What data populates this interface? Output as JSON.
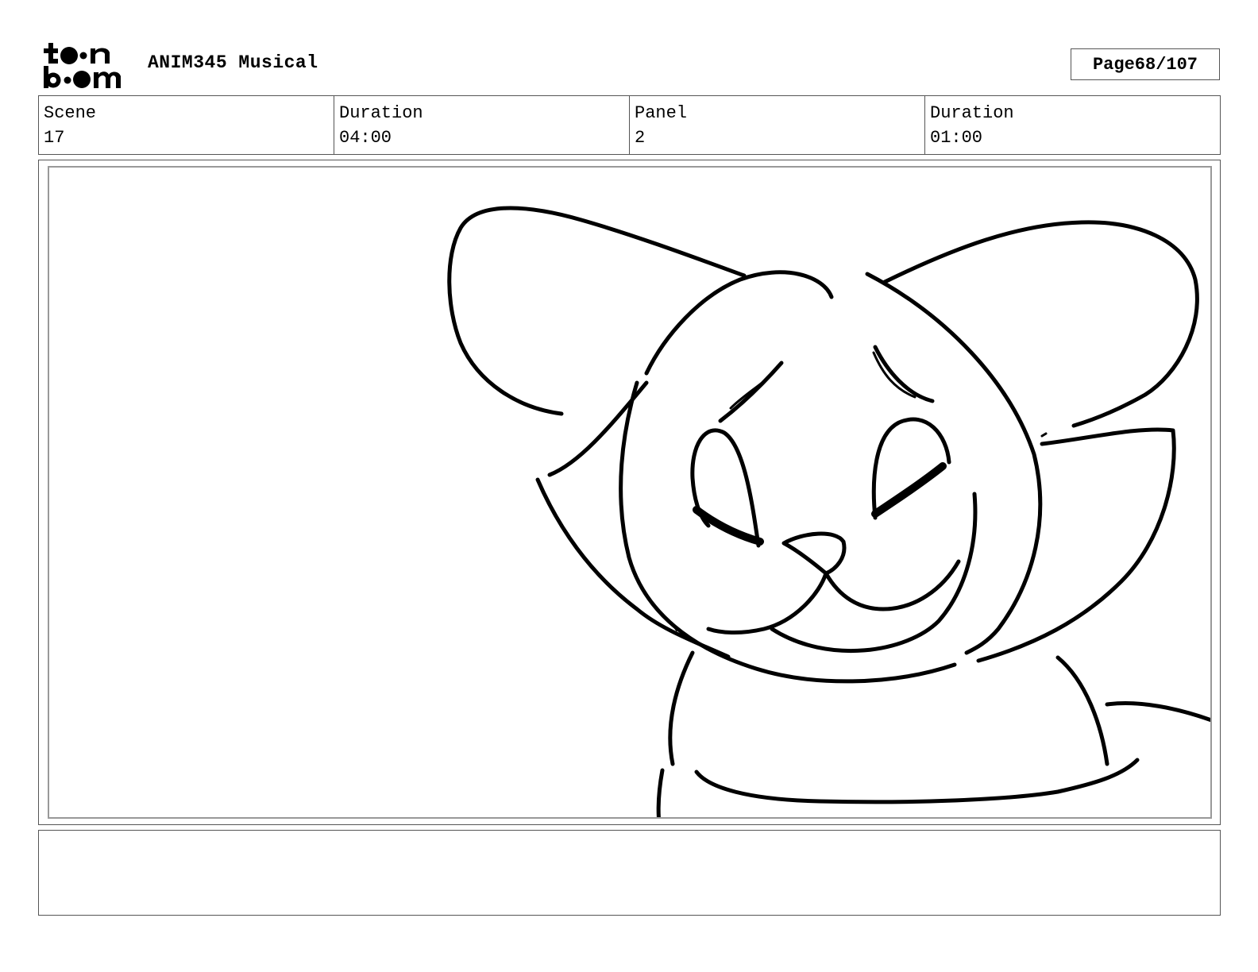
{
  "header": {
    "logo_alt": "toon boom",
    "project_title": "ANIM345 Musical",
    "page_label": "Page",
    "page_number": "68/107"
  },
  "info": {
    "scene_label": "Scene",
    "scene_value": "17",
    "scene_duration_label": "Duration",
    "scene_duration_value": "04:00",
    "panel_label": "Panel",
    "panel_value": "2",
    "panel_duration_label": "Duration",
    "panel_duration_value": "01:00"
  },
  "notes": {
    "text": ""
  },
  "colors": {
    "ink": "#000000",
    "border": "#555555",
    "panel_border": "#999999"
  }
}
